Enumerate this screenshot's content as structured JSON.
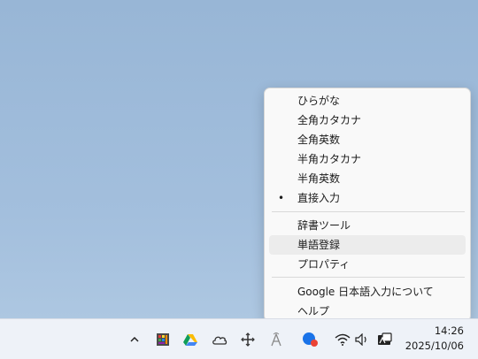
{
  "menu": {
    "items": [
      {
        "label": "ひらがな"
      },
      {
        "label": "全角カタカナ"
      },
      {
        "label": "全角英数"
      },
      {
        "label": "半角カタカナ"
      },
      {
        "label": "半角英数"
      },
      {
        "label": "直接入力",
        "checked": true,
        "check_mark": "•"
      }
    ],
    "items2": [
      {
        "label": "辞書ツール"
      },
      {
        "label": "単語登録",
        "highlighted": true
      },
      {
        "label": "プロパティ"
      }
    ],
    "items3": [
      {
        "label": "Google 日本語入力について"
      },
      {
        "label": "ヘルプ"
      }
    ]
  },
  "taskbar": {
    "time": "14:26",
    "date": "2025/10/06",
    "tray_icons": [
      "chevron-up-icon",
      "app-icon",
      "google-drive-icon",
      "onedrive-icon",
      "move-icon",
      "ime-a-icon",
      "chrome-profile-icon",
      "wifi-icon",
      "volume-icon",
      "ime-mode-icon"
    ]
  },
  "colors": {
    "menu_bg": "#f9f9f9",
    "highlight": "#ececec",
    "taskbar_bg": "#eef2f8",
    "desktop": "#a3bfdd"
  }
}
